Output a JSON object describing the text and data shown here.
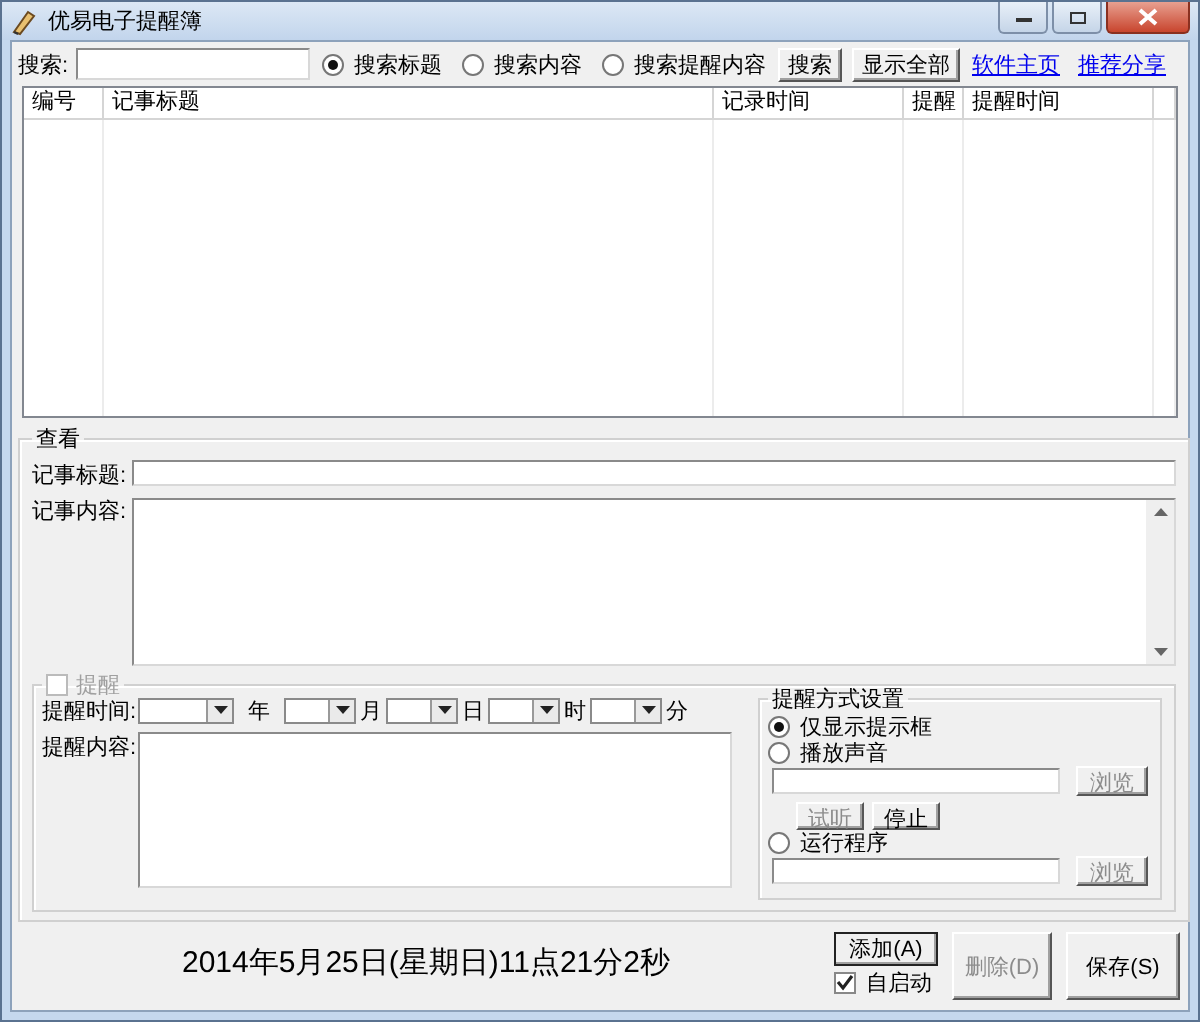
{
  "window": {
    "title": "优易电子提醒簿"
  },
  "search": {
    "label": "搜索:",
    "options": [
      {
        "label": "搜索标题",
        "selected": true
      },
      {
        "label": "搜索内容",
        "selected": false
      },
      {
        "label": "搜索提醒内容",
        "selected": false
      }
    ],
    "buttons": [
      "搜索",
      "显示全部"
    ],
    "links": [
      "软件主页",
      "推荐分享"
    ]
  },
  "table": {
    "columns": [
      "编号",
      "记事标题",
      "记录时间",
      "提醒",
      "提醒时间"
    ]
  },
  "view": {
    "title": "查看",
    "title_label": "记事标题:",
    "content_label": "记事内容:"
  },
  "reminder": {
    "label": "提醒",
    "checked": false,
    "disabled": true,
    "time_label": "提醒时间:",
    "units": [
      "年",
      "月",
      "日",
      "时",
      "分"
    ],
    "content_label": "提醒内容:",
    "method": {
      "title": "提醒方式设置",
      "options": [
        {
          "kind": "plain",
          "label": "仅显示提示框",
          "selected": true
        },
        {
          "kind": "sound",
          "label": "播放声音",
          "selected": false,
          "browse": {
            "label": "浏览",
            "disabled": true
          },
          "preview": {
            "label": "试听",
            "disabled": true
          },
          "stop": {
            "label": "停止",
            "disabled": false
          }
        },
        {
          "kind": "program",
          "label": "运行程序",
          "selected": false,
          "browse": {
            "label": "浏览",
            "disabled": true
          }
        }
      ]
    }
  },
  "footer": {
    "clock": "2014年5月25日(星期日)11点21分2秒",
    "add": {
      "label": "添加(A)",
      "disabled": false
    },
    "autostart": {
      "label": "自启动",
      "checked": true
    },
    "delete": {
      "label": "删除(D)",
      "disabled": true
    },
    "save": {
      "label": "保存(S)",
      "disabled": false
    }
  }
}
